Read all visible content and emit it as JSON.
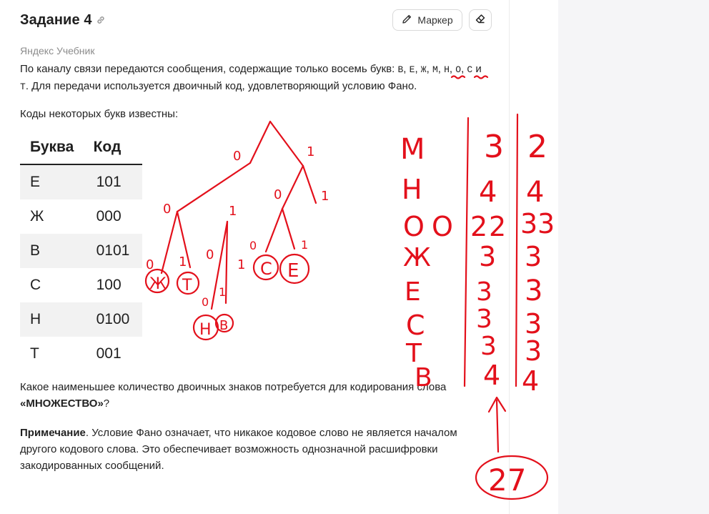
{
  "header": {
    "title": "Задание 4",
    "marker_label": "Маркер"
  },
  "source": "Яндекс Учебник",
  "problem": {
    "intro_a": "По каналу связи передаются сообщения, содержащие только восемь букв: ",
    "letters": [
      "В",
      "Е",
      "Ж",
      "М",
      "Н",
      "О",
      "С",
      "Т"
    ],
    "intro_b": ". Для передачи используется двоичный код, удовлетворяющий условию Фано.",
    "known_codes_label": "Коды некоторых букв известны:",
    "question_a": "Какое наименьшее количество двоичных знаков потребуется для кодирования слова ",
    "question_word": "«МНОЖЕСТВО»",
    "question_b": "?",
    "note_label": "Примечание",
    "note_text": ". Условие Фано означает, что никакое кодовое слово не является началом другого кодового слова. Это обеспечивает возможность однозначной расшифровки закодированных сообщений."
  },
  "table": {
    "headers": [
      "Буква",
      "Код"
    ],
    "rows": [
      {
        "letter": "Е",
        "code": "101"
      },
      {
        "letter": "Ж",
        "code": "000"
      },
      {
        "letter": "В",
        "code": "0101"
      },
      {
        "letter": "С",
        "code": "100"
      },
      {
        "letter": "Н",
        "code": "0100"
      },
      {
        "letter": "Т",
        "code": "001"
      }
    ]
  },
  "annotations": {
    "color": "#e3101b",
    "tree_labels": [
      "0",
      "1",
      "0",
      "1",
      "0",
      "1",
      "0",
      "1",
      "0",
      "1",
      "0",
      "1",
      "0",
      "1"
    ],
    "tree_leaves": [
      "Ж",
      "Т",
      "Н",
      "В",
      "С",
      "Е"
    ],
    "letters_column": [
      "М",
      "Н",
      "О",
      "Ж",
      "Е",
      "С",
      "Т",
      "В"
    ],
    "count_O": "О",
    "lengths_column": [
      "3",
      "4",
      "2",
      "3",
      "3",
      "3",
      "3",
      "4"
    ],
    "extra_O": "2",
    "counts_column": [
      "2",
      "4",
      "3",
      "3",
      "3",
      "3",
      "3",
      "4"
    ],
    "extra_count": "3",
    "total": "27"
  }
}
